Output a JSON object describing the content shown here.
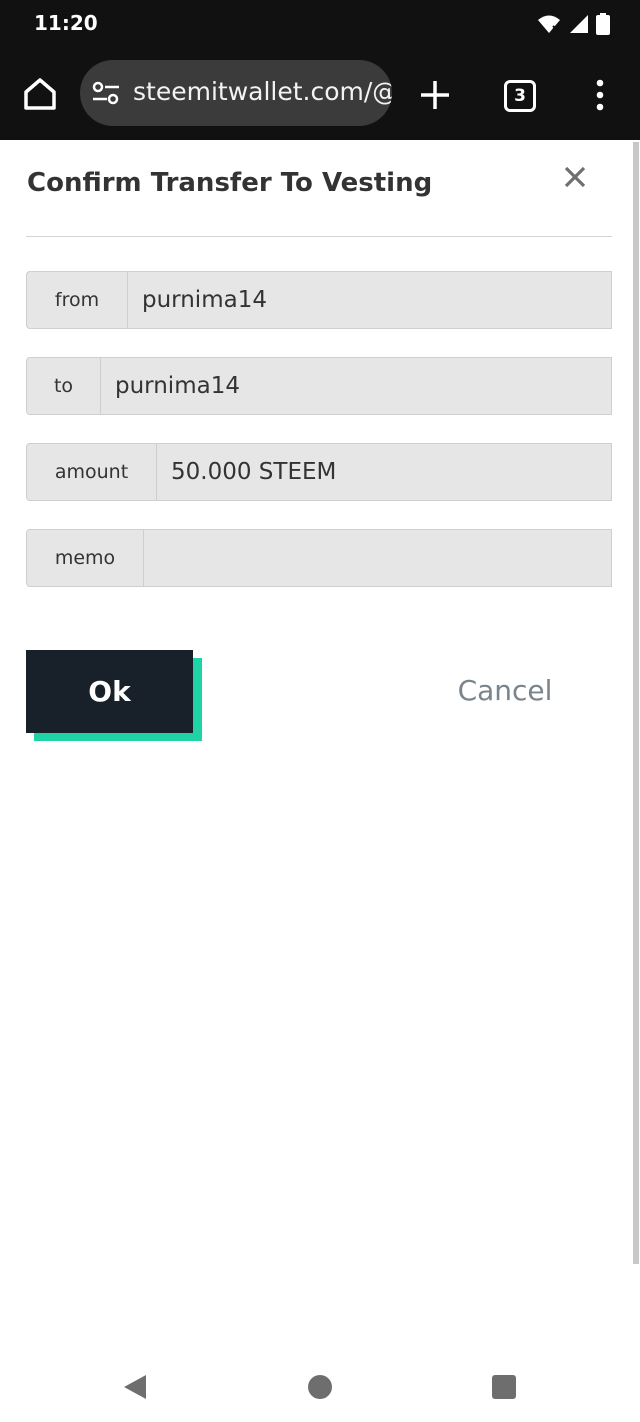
{
  "status_bar": {
    "time": "11:20",
    "icons": [
      "wifi-icon",
      "signal-icon",
      "battery-icon"
    ]
  },
  "browser": {
    "url": "steemitwallet.com/@",
    "tab_count": "3",
    "icons": [
      "home-icon",
      "tune-icon",
      "plus-icon",
      "tabs-icon",
      "more-vert-icon"
    ]
  },
  "dialog": {
    "title": "Confirm Transfer To Vesting",
    "close_icon": "close-icon",
    "fields": [
      {
        "label": "from",
        "value": "purnima14"
      },
      {
        "label": "to",
        "value": "purnima14"
      },
      {
        "label": "amount",
        "value": "50.000 STEEM"
      },
      {
        "label": "memo",
        "value": ""
      }
    ],
    "ok_label": "Ok",
    "cancel_label": "Cancel"
  },
  "colors": {
    "ok_button": "#18202a",
    "ok_accent": "#1fd3a6",
    "field_bg": "#e6e6e6",
    "cancel_text": "#7a848c",
    "toolbar_bg": "#111111"
  },
  "nav_bar": {
    "icons": [
      "back-icon",
      "home-circle-icon",
      "recents-icon"
    ]
  }
}
